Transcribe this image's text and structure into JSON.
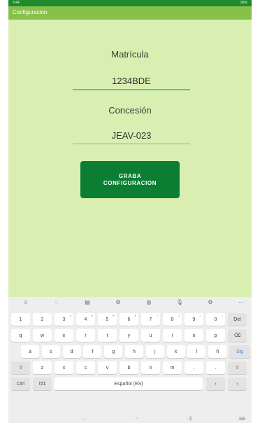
{
  "status_bar": {
    "time": "9:44",
    "indicators": "96%"
  },
  "app_bar": {
    "title": "Configuracion"
  },
  "form": {
    "matricula_label": "Matrícula",
    "matricula_value": "1234BDE",
    "concesion_label": "Concesión",
    "concesion_value": "JEAV-023",
    "save_button": "GRABA\nCONFIGURACION"
  },
  "keyboard": {
    "toolbar": [
      "☺",
      "◌",
      "▤",
      "⚙",
      "◍",
      "🎙",
      "⚙",
      "⋯"
    ],
    "row1": [
      {
        "k": "1",
        "s": ""
      },
      {
        "k": "2",
        "s": "\""
      },
      {
        "k": "3",
        "s": "#"
      },
      {
        "k": "4",
        "s": "$"
      },
      {
        "k": "5",
        "s": "%"
      },
      {
        "k": "6",
        "s": "&"
      },
      {
        "k": "7",
        "s": "/"
      },
      {
        "k": "8",
        "s": "("
      },
      {
        "k": "9",
        "s": ")"
      },
      {
        "k": "0",
        "s": "="
      },
      {
        "k": "Del",
        "s": ""
      }
    ],
    "row2": [
      "q",
      "w",
      "e",
      "r",
      "t",
      "y",
      "u",
      "i",
      "o",
      "p",
      "⌫"
    ],
    "row3": [
      "a",
      "s",
      "d",
      "f",
      "g",
      "h",
      "j",
      "k",
      "l",
      "ñ",
      "Sig"
    ],
    "row4": [
      "⇧",
      "z",
      "x",
      "c",
      "v",
      "b",
      "n",
      "m",
      ",",
      ".",
      "⇧"
    ],
    "row5": {
      "ctrl": "Ctrl",
      "symbols": "!#1",
      "space": "Español (ES)",
      "left": "‹",
      "right": "›"
    },
    "nav": {
      "down": "⌄",
      "home": "○",
      "recents": "|||",
      "ime": "⌨"
    }
  }
}
